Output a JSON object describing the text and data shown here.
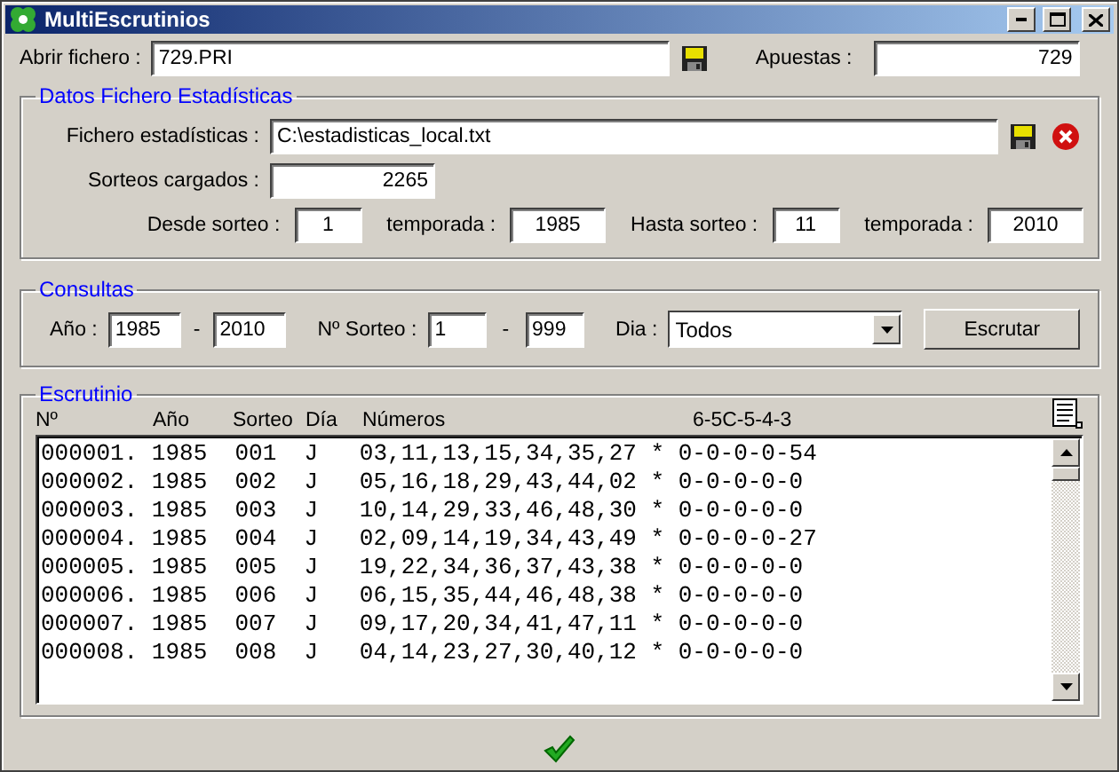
{
  "window": {
    "title": "MultiEscrutinios"
  },
  "open_file": {
    "label": "Abrir fichero :",
    "value": "729.PRI"
  },
  "bets": {
    "label": "Apuestas :",
    "value": "729"
  },
  "stats": {
    "title": "Datos Fichero Estadísticas",
    "file_label": "Fichero estadísticas :",
    "file_value": "C:\\estadisticas_local.txt",
    "loaded_label": "Sorteos cargados :",
    "loaded_value": "2265",
    "range": [
      {
        "label": "Desde sorteo :",
        "value": "1"
      },
      {
        "label": "temporada :",
        "value": "1985"
      },
      {
        "label": "Hasta sorteo :",
        "value": "11"
      },
      {
        "label": "temporada :",
        "value": "2010"
      }
    ]
  },
  "queries": {
    "title": "Consultas",
    "year_label": "Año :",
    "year_from": "1985",
    "year_sep": "-",
    "year_to": "2010",
    "draw_label": "Nº Sorteo :",
    "draw_from": "1",
    "draw_sep": "-",
    "draw_to": "999",
    "day_label": "Dia :",
    "day_value": "Todos",
    "button": "Escrutar"
  },
  "results": {
    "title": "Escrutinio",
    "columns": [
      "Nº",
      "Año",
      "Sorteo",
      "Día",
      "Números",
      "6-5C-5-4-3"
    ],
    "rows": [
      "000001. 1985  001  J   03,11,13,15,34,35,27 * 0-0-0-0-54",
      "000002. 1985  002  J   05,16,18,29,43,44,02 * 0-0-0-0-0",
      "000003. 1985  003  J   10,14,29,33,46,48,30 * 0-0-0-0-0",
      "000004. 1985  004  J   02,09,14,19,34,43,49 * 0-0-0-0-27",
      "000005. 1985  005  J   19,22,34,36,37,43,38 * 0-0-0-0-0",
      "000006. 1985  006  J   06,15,35,44,46,48,38 * 0-0-0-0-0",
      "000007. 1985  007  J   09,17,20,34,41,47,11 * 0-0-0-0-0",
      "000008. 1985  008  J   04,14,23,27,30,40,12 * 0-0-0-0-0"
    ]
  }
}
